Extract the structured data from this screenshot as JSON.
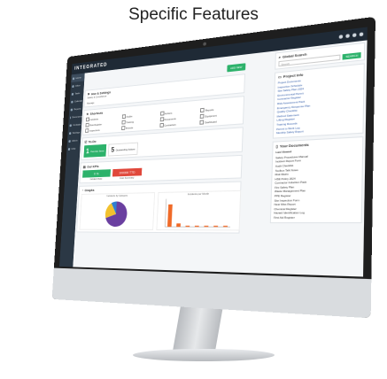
{
  "caption": "Specific Features",
  "app": {
    "logo": "INTEGRATED",
    "go_button": "GO SEARCH"
  },
  "sidebar": {
    "items": [
      {
        "label": "Home"
      },
      {
        "label": "Inbox"
      },
      {
        "label": "Tasks"
      },
      {
        "label": "Calendar"
      },
      {
        "label": "Reports"
      },
      {
        "label": "Documents"
      },
      {
        "label": "Contacts"
      },
      {
        "label": "Settings"
      },
      {
        "label": "Admin"
      },
      {
        "label": "Help"
      }
    ]
  },
  "main": {
    "action_button": "ADD NEW",
    "hse_title": "Hse & Settings",
    "hse_subtitle": "Safety & Compliance",
    "manage_label": "Manage",
    "shortcuts_title": "Shortcuts",
    "shortcuts": [
      "Incidents",
      "Audits",
      "Actions",
      "Reports",
      "Risk Register",
      "Training",
      "Documents",
      "Equipment",
      "Inspections",
      "Permits",
      "Contractors",
      "Dashboard"
    ],
    "todo_title": "To-Do",
    "todos": [
      {
        "num": "1",
        "label": "Overdue Items"
      },
      {
        "num": "5",
        "label": "Outstanding Actions"
      }
    ],
    "kpi_title": "Our KPIs",
    "kpis": [
      {
        "value": "0 %",
        "color": "#2db26b",
        "sub": "Incident Rate"
      },
      {
        "value": "100000 TTD",
        "color": "#e0483b",
        "sub": "Cost Summary"
      }
    ],
    "graphs_title": "Graphs",
    "graph1_title": "Incidents by Category",
    "graph2_title": "Incidents per Month"
  },
  "right": {
    "search_title": "Global Search",
    "search_placeholder": "Search",
    "search_button": "SEARCH",
    "projects_title": "Project Info",
    "projects": [
      "Project Documents",
      "Inspection Schedule",
      "Site Safety Plan 2024",
      "Environmental Permit",
      "Contractor Register",
      "Risk Assessment Pack",
      "Emergency Response Plan",
      "Quality Checklist",
      "Method Statement",
      "Lifting Register",
      "Training Records",
      "Permit to Work Log",
      "Monthly Safety Report"
    ],
    "docs_title": "Your Documents",
    "docs_subtitle": "Last Viewed",
    "docs": [
      "Safety Procedures Manual",
      "Incident Report Form",
      "Audit Checklist",
      "Toolbox Talk Notes",
      "Risk Matrix",
      "HSE Policy 2024",
      "Contractor Induction Pack",
      "Fire Safety Plan",
      "Waste Management Plan",
      "PPE Register",
      "Site Inspection Form",
      "Near Miss Report",
      "Chemical Register",
      "Hazard Identification Log",
      "First Aid Register"
    ]
  },
  "colors": {
    "accent": "#2db26b",
    "alert": "#e0483b",
    "sidebar": "#2b3845"
  },
  "chart_data": [
    {
      "type": "pie",
      "title": "Incidents by Category",
      "categories": [
        "A",
        "B",
        "C"
      ],
      "values": [
        70,
        22,
        8
      ]
    },
    {
      "type": "bar",
      "title": "Incidents per Month",
      "categories": [
        "1",
        "2",
        "3",
        "4",
        "5",
        "6",
        "7"
      ],
      "values": [
        20,
        3,
        1,
        1,
        1,
        1,
        1
      ],
      "ylim": [
        0,
        25
      ]
    }
  ]
}
